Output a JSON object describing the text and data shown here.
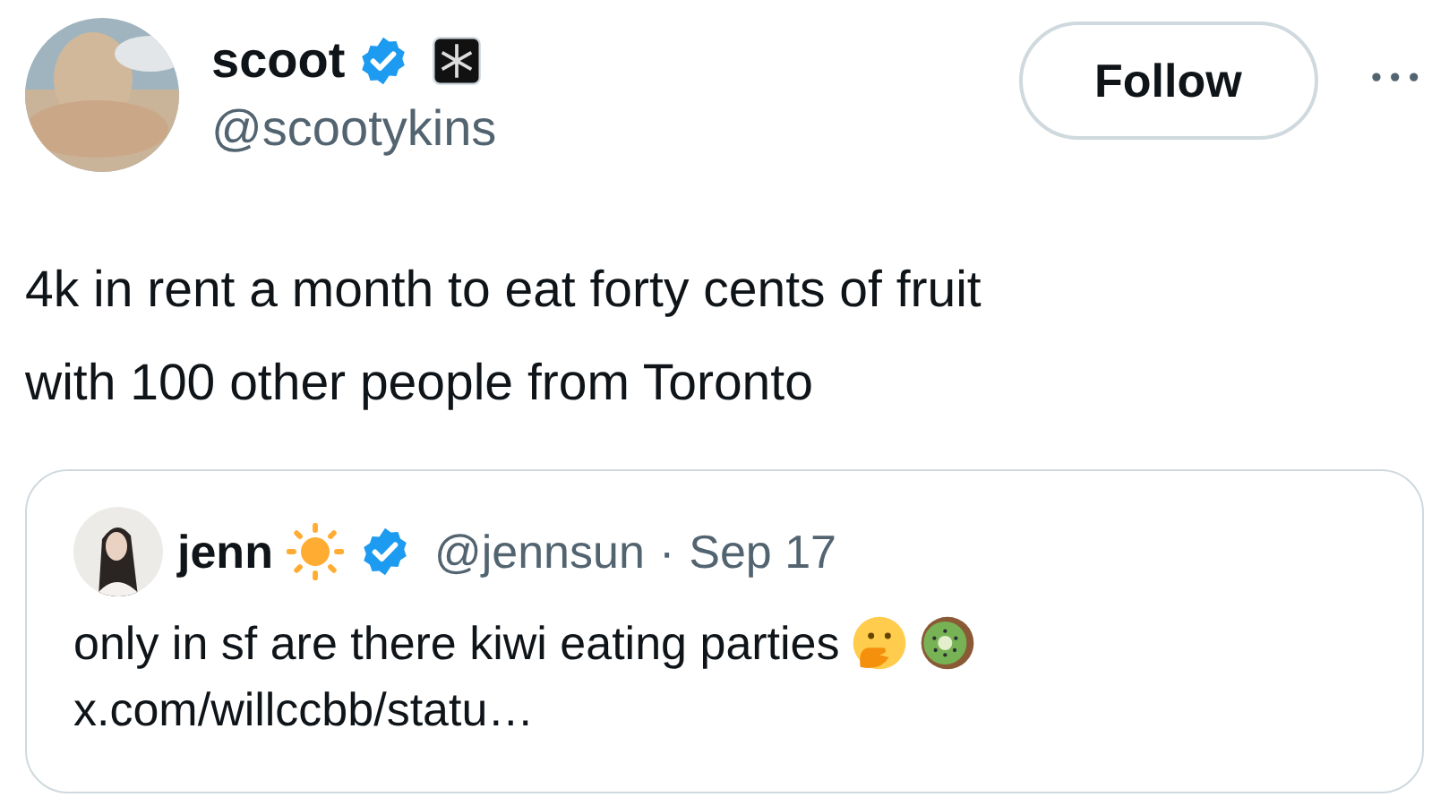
{
  "author": {
    "name": "scoot",
    "verified": true,
    "handle": "@scootykins"
  },
  "follow_button": {
    "label": "Follow"
  },
  "more_button": {
    "label": "•••"
  },
  "tweet_text": [
    "4k in rent a month to eat forty cents of fruit",
    "with 100 other people from Toronto"
  ],
  "quoted_tweet": {
    "name": "jenn",
    "verified": true,
    "handle": "@jennsun",
    "separator": "·",
    "date": "Sep 17",
    "text": "only in sf are there kiwi eating parties",
    "link": "x.com/willccbb/statu…"
  }
}
